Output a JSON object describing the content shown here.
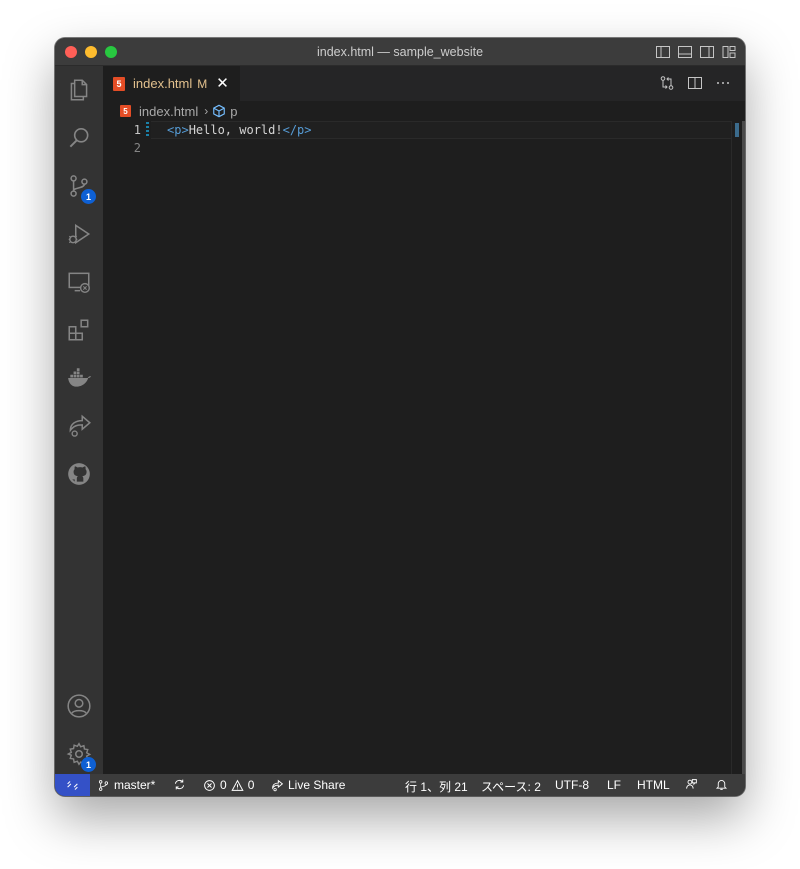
{
  "window": {
    "title": "index.html — sample_website"
  },
  "activity_bar": {
    "items": [
      {
        "name": "explorer",
        "icon": "files-icon"
      },
      {
        "name": "search",
        "icon": "search-icon"
      },
      {
        "name": "source-control",
        "icon": "source-control-icon",
        "badge": "1"
      },
      {
        "name": "run-and-debug",
        "icon": "run-debug-icon"
      },
      {
        "name": "remote-explorer",
        "icon": "remote-explorer-icon"
      },
      {
        "name": "extensions",
        "icon": "extensions-icon"
      },
      {
        "name": "docker",
        "icon": "docker-icon"
      },
      {
        "name": "live-share",
        "icon": "live-share-icon"
      },
      {
        "name": "github",
        "icon": "github-icon"
      }
    ],
    "bottom": [
      {
        "name": "accounts",
        "icon": "account-icon"
      },
      {
        "name": "manage",
        "icon": "gear-icon",
        "badge": "1"
      }
    ]
  },
  "tab": {
    "label": "index.html",
    "modified_flag": "M",
    "close_glyph": "✕",
    "file_icon": "5"
  },
  "breadcrumb": {
    "file": "index.html",
    "separator": "›",
    "symbol": "p"
  },
  "editor": {
    "line_numbers": [
      "1",
      "2"
    ],
    "lines": [
      {
        "open_tag": "<p>",
        "text": "Hello, world!",
        "close_tag": "</p>"
      },
      {
        "open_tag": "",
        "text": "",
        "close_tag": ""
      }
    ],
    "active_line": 1
  },
  "status_bar": {
    "branch": "master*",
    "errors": "0",
    "warnings": "0",
    "live_share": "Live Share",
    "cursor": "行 1、列 21",
    "spaces": "スペース: 2",
    "encoding": "UTF-8",
    "eol": "LF",
    "language": "HTML"
  },
  "colors": {
    "activity_bar_bg": "#333333",
    "editor_bg": "#1e1e1e",
    "status_bar_bg": "#3c3c3c",
    "remote_button_bg": "#3451c7",
    "badge_bg": "#0e60d4",
    "modified_tab_text": "#e2c08d",
    "html_tag": "#569cd6",
    "html_icon": "#e44d26"
  }
}
